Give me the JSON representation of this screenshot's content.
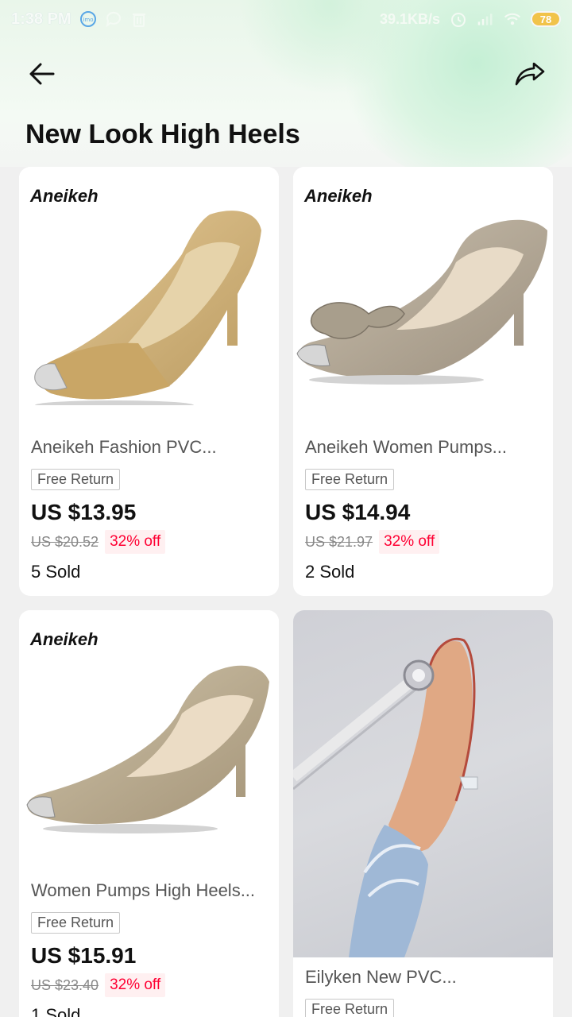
{
  "status_bar": {
    "time": "1:38 PM",
    "net_speed": "39.1KB/s",
    "battery": "78"
  },
  "header": {
    "title": "New Look High Heels"
  },
  "products": [
    {
      "brand": "Aneikeh",
      "title": "Aneikeh Fashion PVC...",
      "badge": "Free Return",
      "price": "US $13.95",
      "old_price": "US $20.52",
      "discount": "32% off",
      "sold": "5 Sold"
    },
    {
      "brand": "Aneikeh",
      "title": "Aneikeh Women Pumps...",
      "badge": "Free Return",
      "price": "US $14.94",
      "old_price": "US $21.97",
      "discount": "32% off",
      "sold": "2 Sold"
    },
    {
      "brand": "Aneikeh",
      "title": "Women Pumps High Heels...",
      "badge": "Free Return",
      "price": "US $15.91",
      "old_price": "US $23.40",
      "discount": "32% off",
      "sold": "1 Sold"
    },
    {
      "title": "Eilyken New PVC...",
      "badge": "Free Return"
    }
  ]
}
